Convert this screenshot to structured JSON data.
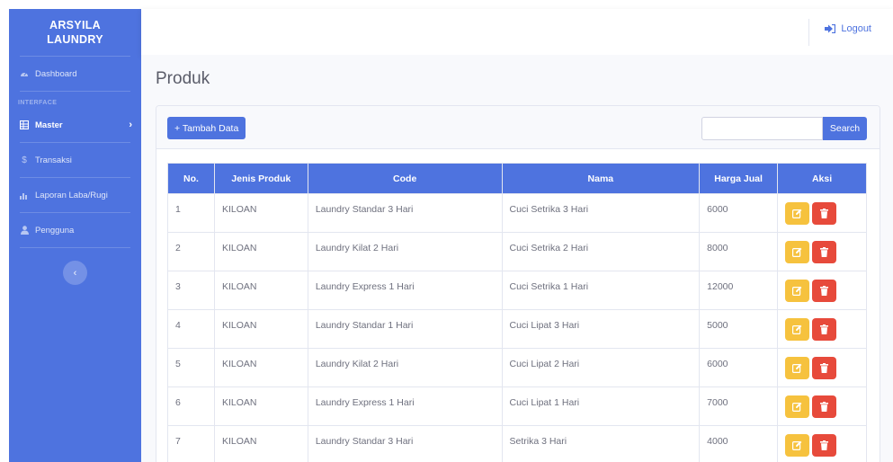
{
  "sidebar": {
    "brand_line1": "ARSYILA",
    "brand_line2": "LAUNDRY",
    "heading": "INTERFACE",
    "items": [
      {
        "label": "Dashboard",
        "icon": "tachometer-icon"
      },
      {
        "label": "Master",
        "icon": "table-icon"
      },
      {
        "label": "Transaksi",
        "icon": "dollar-icon"
      },
      {
        "label": "Laporan Laba/Rugi",
        "icon": "chart-bar-icon"
      },
      {
        "label": "Pengguna",
        "icon": "user-icon"
      }
    ]
  },
  "topbar": {
    "logout_label": "Logout"
  },
  "page": {
    "title": "Produk"
  },
  "toolbar": {
    "add_label": "+ Tambah Data",
    "search_value": "",
    "search_label": "Search"
  },
  "table": {
    "headers": [
      "No.",
      "Jenis Produk",
      "Code",
      "Nama",
      "Harga Jual",
      "Aksi"
    ],
    "rows": [
      {
        "no": "1",
        "jenis": "KILOAN",
        "code": "Laundry Standar 3 Hari",
        "nama": "Cuci Setrika 3 Hari",
        "harga": "6000"
      },
      {
        "no": "2",
        "jenis": "KILOAN",
        "code": "Laundry Kilat 2 Hari",
        "nama": "Cuci Setrika 2 Hari",
        "harga": "8000"
      },
      {
        "no": "3",
        "jenis": "KILOAN",
        "code": "Laundry Express 1 Hari",
        "nama": "Cuci Setrika 1 Hari",
        "harga": "12000"
      },
      {
        "no": "4",
        "jenis": "KILOAN",
        "code": "Laundry Standar 1 Hari",
        "nama": "Cuci Lipat 3 Hari",
        "harga": "5000"
      },
      {
        "no": "5",
        "jenis": "KILOAN",
        "code": "Laundry Kilat 2 Hari",
        "nama": "Cuci Lipat 2 Hari",
        "harga": "6000"
      },
      {
        "no": "6",
        "jenis": "KILOAN",
        "code": "Laundry Express 1 Hari",
        "nama": "Cuci Lipat 1 Hari",
        "harga": "7000"
      },
      {
        "no": "7",
        "jenis": "KILOAN",
        "code": "Laundry Standar 3 Hari",
        "nama": "Setrika 3 Hari",
        "harga": "4000"
      }
    ]
  },
  "colors": {
    "primary": "#4e73df",
    "warning": "#f6c23e",
    "danger": "#e74a3b"
  }
}
